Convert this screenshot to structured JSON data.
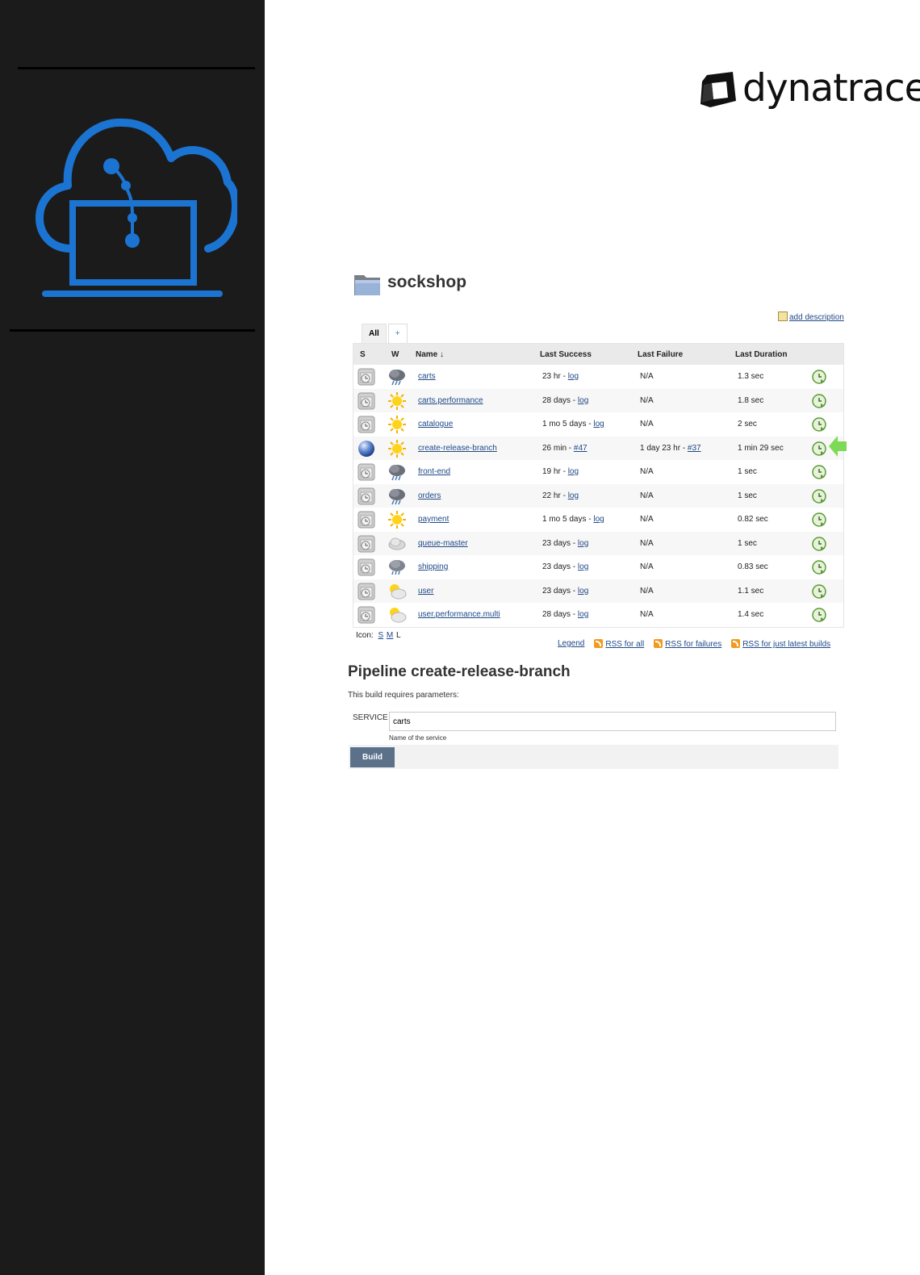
{
  "brand": {
    "name": "dynatrace",
    "accent": "#1b74d1"
  },
  "folder": {
    "title": "sockshop"
  },
  "actions": {
    "add_description": "add description"
  },
  "tabs": [
    {
      "label": "All",
      "active": true
    },
    {
      "label": "+"
    }
  ],
  "table": {
    "headers": {
      "s": "S",
      "w": "W",
      "name": "Name ↓",
      "last_success": "Last Success",
      "last_failure": "Last Failure",
      "last_duration": "Last Duration"
    },
    "rows": [
      {
        "status": "disabled",
        "weather": "storm",
        "name": "carts",
        "success_time": "23 hr - ",
        "success_link": "log",
        "failure_time": "N/A",
        "failure_link": "",
        "duration": "1.3 sec"
      },
      {
        "status": "disabled",
        "weather": "sunny",
        "name": "carts.performance",
        "success_time": "28 days - ",
        "success_link": "log",
        "failure_time": "N/A",
        "failure_link": "",
        "duration": "1.8 sec"
      },
      {
        "status": "disabled",
        "weather": "sunny",
        "name": "catalogue",
        "success_time": "1 mo 5 days - ",
        "success_link": "log",
        "failure_time": "N/A",
        "failure_link": "",
        "duration": "2 sec"
      },
      {
        "status": "success",
        "weather": "sunny",
        "name": "create-release-branch",
        "success_time": "26 min - ",
        "success_link": "#47",
        "failure_time": "1 day 23 hr - ",
        "failure_link": "#37",
        "duration": "1 min 29 sec"
      },
      {
        "status": "disabled",
        "weather": "storm",
        "name": "front-end",
        "success_time": "19 hr - ",
        "success_link": "log",
        "failure_time": "N/A",
        "failure_link": "",
        "duration": "1 sec"
      },
      {
        "status": "disabled",
        "weather": "storm",
        "name": "orders",
        "success_time": "22 hr - ",
        "success_link": "log",
        "failure_time": "N/A",
        "failure_link": "",
        "duration": "1 sec"
      },
      {
        "status": "disabled",
        "weather": "sunny",
        "name": "payment",
        "success_time": "1 mo 5 days - ",
        "success_link": "log",
        "failure_time": "N/A",
        "failure_link": "",
        "duration": "0.82 sec"
      },
      {
        "status": "disabled",
        "weather": "cloudy",
        "name": "queue-master",
        "success_time": "23 days - ",
        "success_link": "log",
        "failure_time": "N/A",
        "failure_link": "",
        "duration": "1 sec"
      },
      {
        "status": "disabled",
        "weather": "rain",
        "name": "shipping",
        "success_time": "23 days - ",
        "success_link": "log",
        "failure_time": "N/A",
        "failure_link": "",
        "duration": "0.83 sec"
      },
      {
        "status": "disabled",
        "weather": "partly-cloudy",
        "name": "user",
        "success_time": "23 days - ",
        "success_link": "log",
        "failure_time": "N/A",
        "failure_link": "",
        "duration": "1.1 sec"
      },
      {
        "status": "disabled",
        "weather": "partly-cloudy",
        "name": "user.performance.multi",
        "success_time": "28 days - ",
        "success_link": "log",
        "failure_time": "N/A",
        "failure_link": "",
        "duration": "1.4 sec"
      }
    ]
  },
  "icon_size": {
    "label": "Icon:",
    "options": [
      "S",
      "M",
      "L"
    ]
  },
  "legend": {
    "legend": "Legend",
    "rss_all": "RSS for all",
    "rss_failures": "RSS for failures",
    "rss_latest": "RSS for just latest builds"
  },
  "pipeline": {
    "title": "Pipeline create-release-branch",
    "subtitle": "This build requires parameters:",
    "param_label": "SERVICE",
    "param_value": "carts",
    "param_description": "Name of the service",
    "build_label": "Build"
  }
}
